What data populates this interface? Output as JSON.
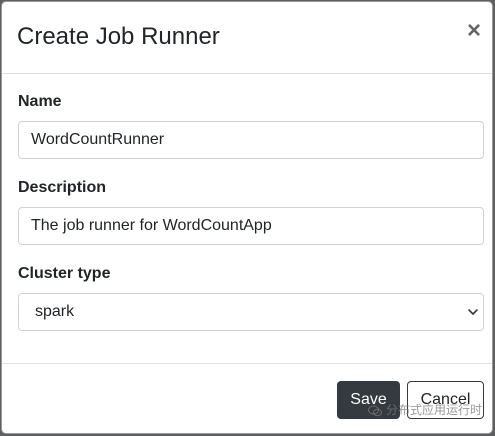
{
  "modal": {
    "title": "Create Job Runner",
    "close_symbol": "×"
  },
  "form": {
    "name": {
      "label": "Name",
      "value": "WordCountRunner"
    },
    "description": {
      "label": "Description",
      "value": "The job runner for WordCountApp"
    },
    "cluster_type": {
      "label": "Cluster type",
      "selected": "spark"
    }
  },
  "footer": {
    "save_label": "Save",
    "cancel_label": "Cancel"
  },
  "watermark": {
    "text": "分布式应用运行时"
  },
  "colors": {
    "primary_button": "#343a40",
    "backdrop": "#5e5f60"
  }
}
